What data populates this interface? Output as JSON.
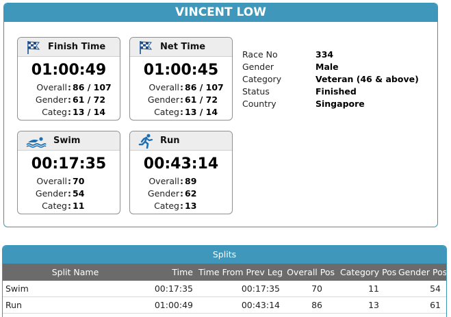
{
  "athlete": {
    "name": "VINCENT LOW"
  },
  "cards": {
    "finish": {
      "title": "Finish Time",
      "time": "01:00:49",
      "icon": "checkered-flag-icon",
      "overall_label": "Overall",
      "overall": "86 / 107",
      "gender_label": "Gender",
      "gender": "61 / 72",
      "categ_label": "Categ",
      "categ": "13 / 14"
    },
    "net": {
      "title": "Net Time",
      "time": "01:00:45",
      "icon": "checkered-flag-icon",
      "overall_label": "Overall",
      "overall": "86 / 107",
      "gender_label": "Gender",
      "gender": "61 / 72",
      "categ_label": "Categ",
      "categ": "13 / 14"
    },
    "swim": {
      "title": "Swim",
      "time": "00:17:35",
      "icon": "swimmer-icon",
      "overall_label": "Overall",
      "overall": "70",
      "gender_label": "Gender",
      "gender": "54",
      "categ_label": "Categ",
      "categ": "11"
    },
    "run": {
      "title": "Run",
      "time": "00:43:14",
      "icon": "runner-icon",
      "overall_label": "Overall",
      "overall": "89",
      "gender_label": "Gender",
      "gender": "62",
      "categ_label": "Categ",
      "categ": "13"
    }
  },
  "info": {
    "race_no_label": "Race No",
    "race_no": "334",
    "gender_label": "Gender",
    "gender": "Male",
    "category_label": "Category",
    "category": "Veteran (46 & above)",
    "status_label": "Status",
    "status": "Finished",
    "country_label": "Country",
    "country": "Singapore"
  },
  "splits": {
    "caption": "Splits",
    "headers": [
      "Split Name",
      "Time",
      "Time From Prev Leg",
      "Overall Pos",
      "Category Pos",
      "Gender Pos"
    ],
    "rows": [
      [
        "Swim",
        "00:17:35",
        "00:17:35",
        "70",
        "11",
        "54"
      ],
      [
        "Run",
        "01:00:49",
        "00:43:14",
        "86",
        "13",
        "61"
      ]
    ]
  },
  "colors": {
    "header_blue": "#3f98bb",
    "table_header_gray": "#6b6b6b",
    "card_head_gray": "#ededed",
    "icon_blue": "#1b6fb5"
  }
}
